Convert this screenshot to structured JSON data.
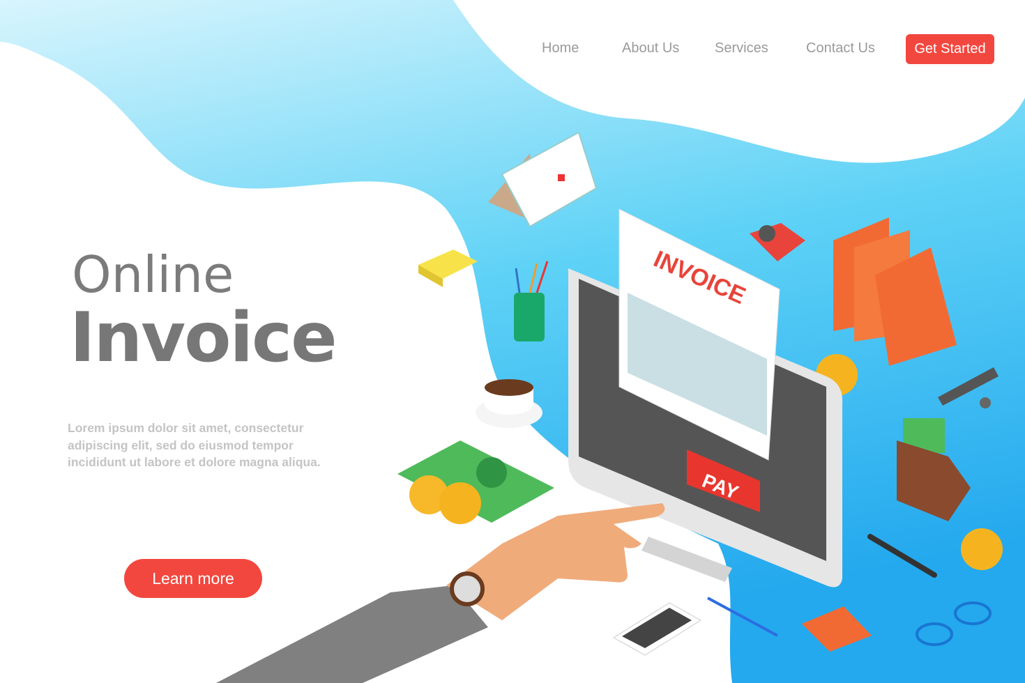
{
  "nav": {
    "items": [
      {
        "label": "Home"
      },
      {
        "label": "About Us"
      },
      {
        "label": "Services"
      },
      {
        "label": "Contact Us"
      }
    ],
    "cta_label": "Get Started"
  },
  "hero": {
    "title_line1": "Online",
    "title_line2": "Invoice",
    "description": "Lorem ipsum dolor sit amet, consectetur adipiscing elit, sed do eiusmod tempor incididunt ut labore et dolore magna aliqua.",
    "button_label": "Learn more"
  },
  "illustration": {
    "document_title": "INVOICE",
    "pay_label": "PAY"
  },
  "colors": {
    "accent": "#f2473f",
    "blue": "#3ec3f1",
    "text": "#7b7b7b"
  }
}
